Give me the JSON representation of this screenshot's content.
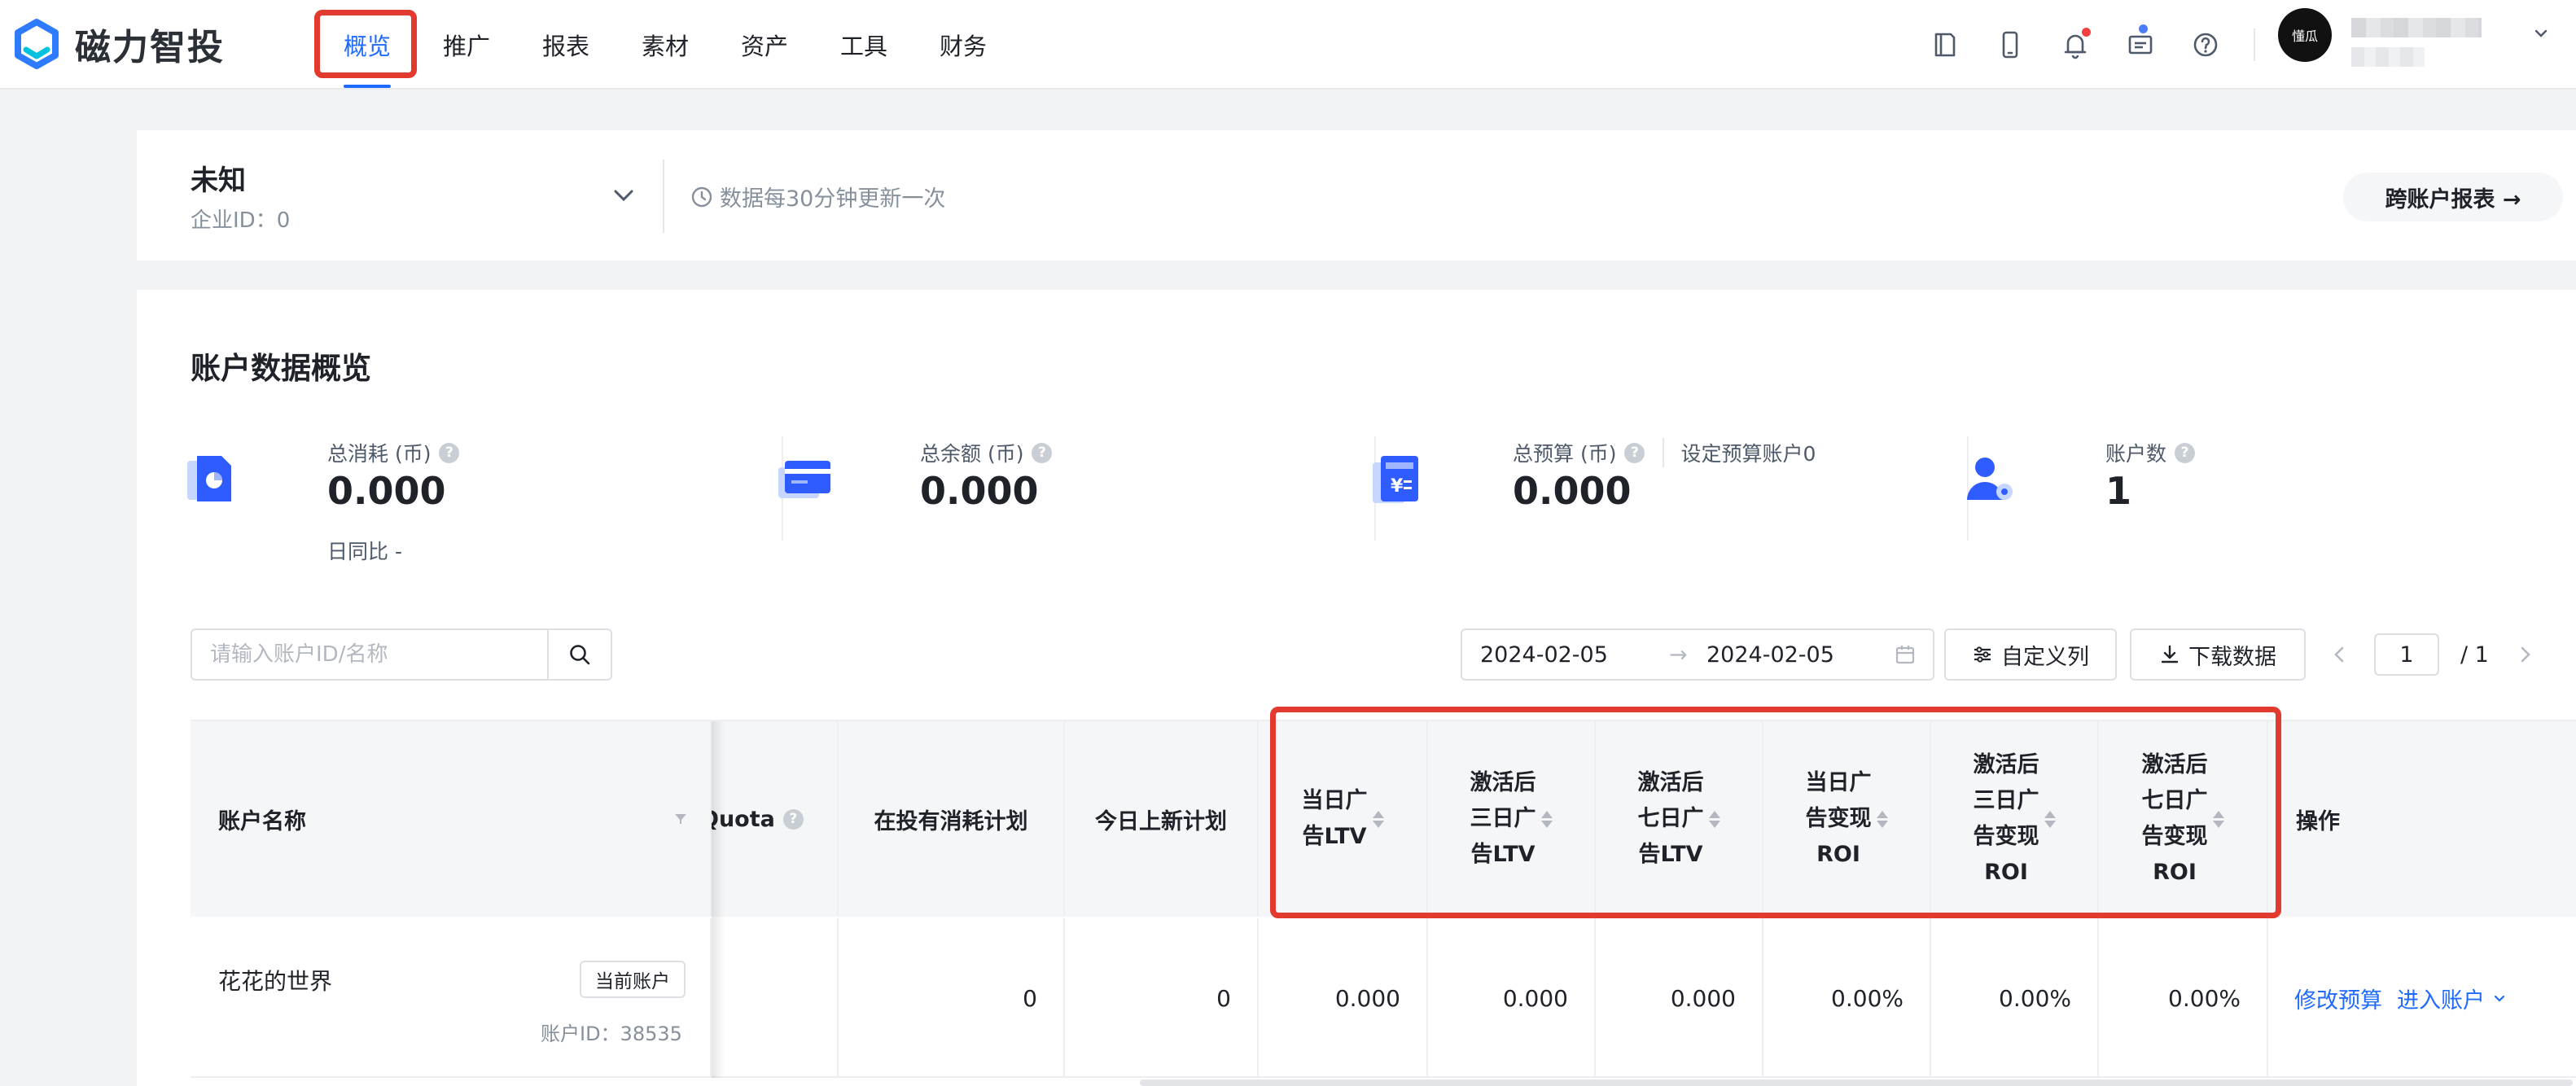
{
  "brand": {
    "name": "磁力智投",
    "accent": "#1f6bff",
    "highlight": "#e23a2f"
  },
  "nav": {
    "items": [
      {
        "label": "概览",
        "active": true
      },
      {
        "label": "推广"
      },
      {
        "label": "报表"
      },
      {
        "label": "素材"
      },
      {
        "label": "资产"
      },
      {
        "label": "工具"
      },
      {
        "label": "财务"
      }
    ]
  },
  "header_icons": [
    "tablet-icon",
    "phone-icon",
    "bell-icon",
    "message-icon",
    "help-icon"
  ],
  "user": {
    "avatar_text": "懂瓜"
  },
  "account": {
    "name": "未知",
    "enterprise_id": "企业ID：0",
    "update_note": "数据每30分钟更新一次",
    "cross_report": "跨账户报表 →"
  },
  "overview": {
    "title": "账户数据概览",
    "metrics": [
      {
        "label": "总消耗 (币)",
        "value": "0.000",
        "sub": "日同比 -"
      },
      {
        "label": "总余额 (币)",
        "value": "0.000"
      },
      {
        "label": "总预算 (币)",
        "value": "0.000",
        "extra": "设定预算账户0"
      },
      {
        "label": "账户数",
        "value": "1"
      }
    ]
  },
  "toolbar": {
    "search_placeholder": "请输入账户ID/名称",
    "date_start": "2024-02-05",
    "date_arrow": "→",
    "date_end": "2024-02-05",
    "custom_columns": "自定义列",
    "download": "下载数据",
    "page_current": "1",
    "page_total": "/ 1"
  },
  "table": {
    "headers": {
      "account_name": "账户名称",
      "quota": "Quota",
      "active_plans": "在投有消耗计划",
      "new_plans": "今日上新计划",
      "day_ltv": [
        "当日广",
        "告LTV"
      ],
      "d3_ltv": [
        "激活后",
        "三日广",
        "告LTV"
      ],
      "d7_ltv": [
        "激活后",
        "七日广",
        "告LTV"
      ],
      "day_roi": [
        "当日广",
        "告变现",
        "ROI"
      ],
      "d3_roi": [
        "激活后",
        "三日广",
        "告变现",
        "ROI"
      ],
      "d7_roi": [
        "激活后",
        "七日广",
        "告变现",
        "ROI"
      ],
      "operation": "操作"
    },
    "rows": [
      {
        "account_name": "花花的世界",
        "tag": "当前账户",
        "account_id": "账户ID：38535",
        "active_plans": "0",
        "new_plans": "0",
        "day_ltv": "0.000",
        "d3_ltv": "0.000",
        "d7_ltv": "0.000",
        "day_roi": "0.00%",
        "d3_roi": "0.00%",
        "d7_roi": "0.00%",
        "edit_budget": "修改预算",
        "enter_account": "进入账户"
      }
    ]
  }
}
